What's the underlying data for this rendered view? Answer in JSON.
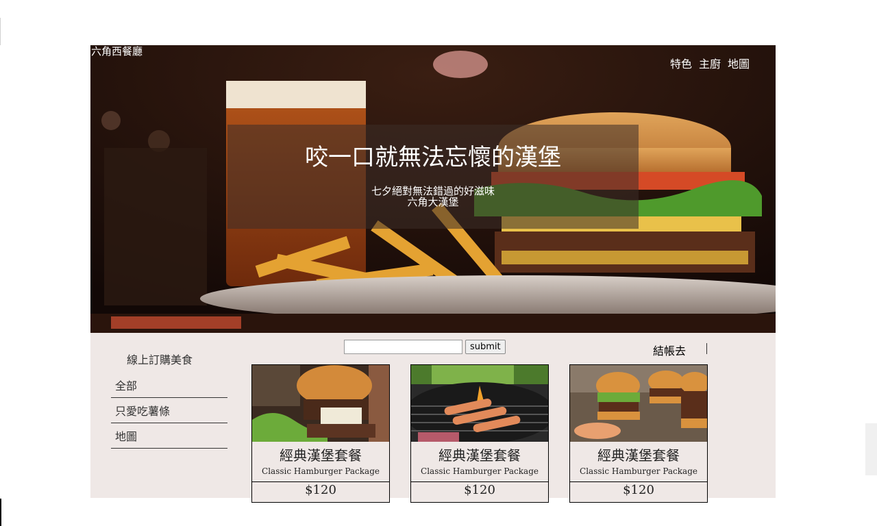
{
  "site": {
    "title": "六角西餐廳"
  },
  "nav": {
    "items": [
      "特色",
      "主廚",
      "地圖"
    ]
  },
  "hero": {
    "heading": "咬一口就無法忘懷的漢堡",
    "subline1": "七夕絕對無法錯過的好滋味",
    "subline2": "六角大漢堡"
  },
  "search": {
    "value": "",
    "placeholder": "",
    "submit_label": "submit"
  },
  "cart": {
    "checkout_label": "結帳去"
  },
  "sidebar": {
    "title": "線上訂購美食",
    "items": [
      "全部",
      "只愛吃薯條",
      "地圖"
    ]
  },
  "products": [
    {
      "name_zh": "經典漢堡套餐",
      "name_en": "Classic Hamburger Package",
      "price": "$120",
      "image": "burger-with-lettuce"
    },
    {
      "name_zh": "經典漢堡套餐",
      "name_en": "Classic Hamburger Package",
      "price": "$120",
      "image": "sausages-on-grill"
    },
    {
      "name_zh": "經典漢堡套餐",
      "name_en": "Classic Hamburger Package",
      "price": "$120",
      "image": "mini-burgers"
    }
  ],
  "colors": {
    "content_bg": "#efe8e6",
    "hero_overlay": "#3c2d28",
    "text_dark": "#333333"
  }
}
